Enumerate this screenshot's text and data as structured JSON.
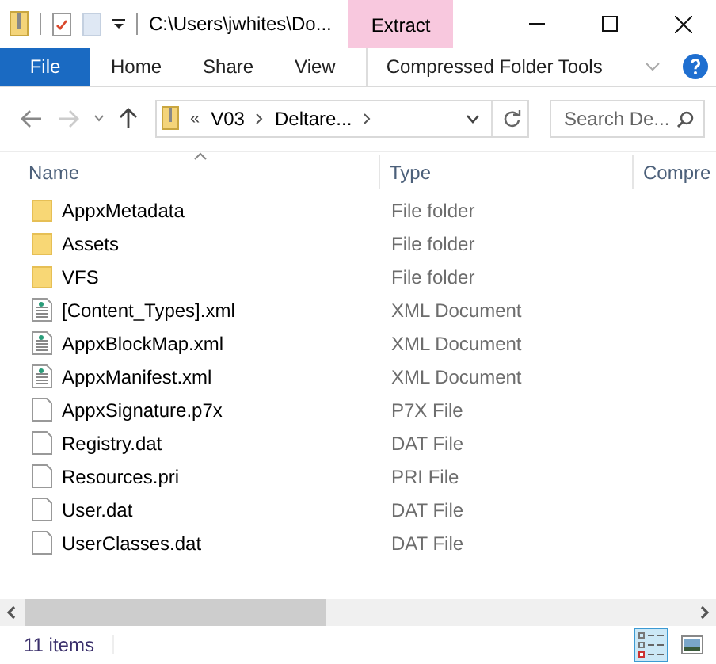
{
  "window": {
    "title": "C:\\Users\\jwhites\\Do...",
    "context_tab": "Extract"
  },
  "ribbon_tabs": [
    {
      "label": "File",
      "kind": "file"
    },
    {
      "label": "Home",
      "kind": "tab"
    },
    {
      "label": "Share",
      "kind": "tab"
    },
    {
      "label": "View",
      "kind": "tab"
    },
    {
      "label": "Compressed Folder Tools",
      "kind": "context"
    }
  ],
  "address": {
    "overflow": "«",
    "parts": [
      "V03",
      "Deltare..."
    ]
  },
  "search": {
    "placeholder": "Search De..."
  },
  "columns": [
    "Name",
    "Type",
    "Compre"
  ],
  "rows": [
    {
      "name": "AppxMetadata",
      "type": "File folder",
      "kind": "folder"
    },
    {
      "name": "Assets",
      "type": "File folder",
      "kind": "folder"
    },
    {
      "name": "VFS",
      "type": "File folder",
      "kind": "folder"
    },
    {
      "name": "[Content_Types].xml",
      "type": "XML Document",
      "kind": "xml"
    },
    {
      "name": "AppxBlockMap.xml",
      "type": "XML Document",
      "kind": "xml"
    },
    {
      "name": "AppxManifest.xml",
      "type": "XML Document",
      "kind": "xml"
    },
    {
      "name": "AppxSignature.p7x",
      "type": "P7X File",
      "kind": "file"
    },
    {
      "name": "Registry.dat",
      "type": "DAT File",
      "kind": "file"
    },
    {
      "name": "Resources.pri",
      "type": "PRI File",
      "kind": "file"
    },
    {
      "name": "User.dat",
      "type": "DAT File",
      "kind": "file"
    },
    {
      "name": "UserClasses.dat",
      "type": "DAT File",
      "kind": "file"
    }
  ],
  "status_bar": {
    "count": "11 items"
  },
  "views": [
    {
      "kind": "details",
      "selected": true
    },
    {
      "kind": "large",
      "selected": false
    }
  ]
}
